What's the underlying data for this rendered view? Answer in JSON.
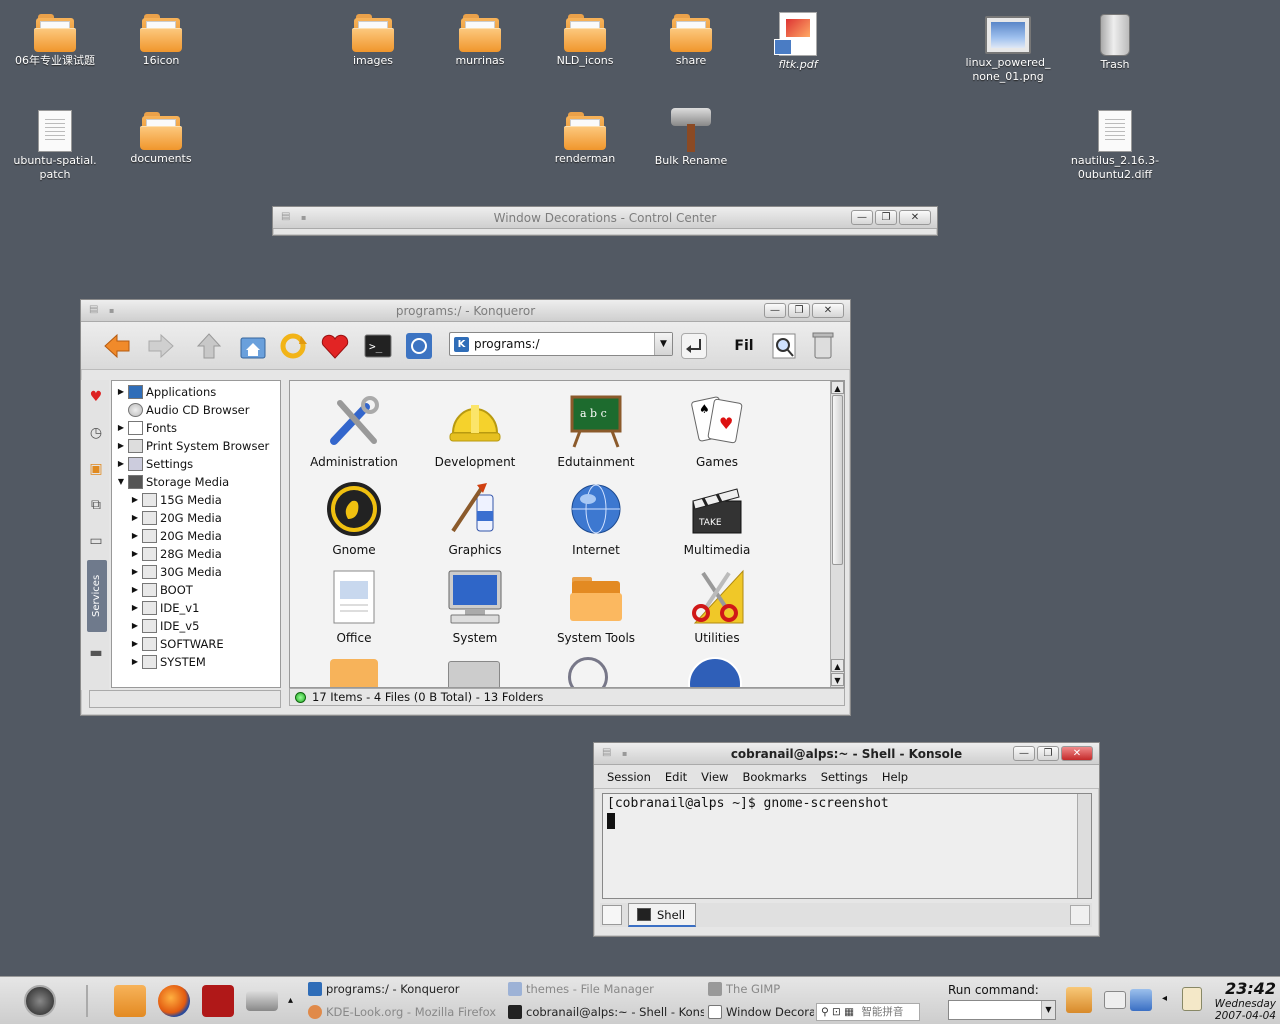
{
  "desktop": {
    "icons": [
      {
        "label": "06年专业课试题",
        "type": "folder"
      },
      {
        "label": "16icon",
        "type": "folder"
      },
      {
        "label": "images",
        "type": "folder"
      },
      {
        "label": "murrinas",
        "type": "folder"
      },
      {
        "label": "NLD_icons",
        "type": "folder"
      },
      {
        "label": "share",
        "type": "folder"
      },
      {
        "label": "fltk.pdf",
        "type": "pdf"
      },
      {
        "label": "linux_powered_\nnone_01.png",
        "type": "image"
      },
      {
        "label": "Trash",
        "type": "trash"
      },
      {
        "label": "ubuntu-spatial.\npatch",
        "type": "document"
      },
      {
        "label": "documents",
        "type": "folder"
      },
      {
        "label": "renderman",
        "type": "folder"
      },
      {
        "label": "Bulk Rename",
        "type": "app"
      },
      {
        "label": "nautilus_2.16.3-\n0ubuntu2.diff",
        "type": "document"
      }
    ]
  },
  "control_center": {
    "title": "Window Decorations - Control Center"
  },
  "konqueror": {
    "title": "programs:/ - Konqueror",
    "location": "programs:/",
    "toolbar": {
      "back": "back-arrow-icon",
      "forward": "forward-arrow-icon",
      "up": "up-arrow-icon",
      "home": "home-icon",
      "reload": "reload-icon",
      "bookmarks": "heart-icon",
      "terminal": "terminal-icon",
      "accessibility": "accessibility-icon",
      "go": "go-icon",
      "find": "Fil",
      "zoom": "zoom-icon",
      "trash": "trash-icon"
    },
    "tree": [
      {
        "label": "Applications",
        "level": 0,
        "expand": "collapsed",
        "icon": "kde-icon"
      },
      {
        "label": "Audio CD Browser",
        "level": 0,
        "expand": "none",
        "icon": "cd-icon"
      },
      {
        "label": "Fonts",
        "level": 0,
        "expand": "collapsed",
        "icon": "fonts-icon"
      },
      {
        "label": "Print System Browser",
        "level": 0,
        "expand": "collapsed",
        "icon": "printer-icon"
      },
      {
        "label": "Settings",
        "level": 0,
        "expand": "collapsed",
        "icon": "settings-icon"
      },
      {
        "label": "Storage Media",
        "level": 0,
        "expand": "expanded",
        "icon": "storage-icon"
      },
      {
        "label": "15G Media",
        "level": 1,
        "expand": "collapsed",
        "icon": "drive-icon"
      },
      {
        "label": "20G Media",
        "level": 1,
        "expand": "collapsed",
        "icon": "drive-icon"
      },
      {
        "label": "20G Media",
        "level": 1,
        "expand": "collapsed",
        "icon": "drive-icon"
      },
      {
        "label": "28G Media",
        "level": 1,
        "expand": "collapsed",
        "icon": "drive-icon"
      },
      {
        "label": "30G Media",
        "level": 1,
        "expand": "collapsed",
        "icon": "drive-icon"
      },
      {
        "label": "BOOT",
        "level": 1,
        "expand": "collapsed",
        "icon": "drive-icon"
      },
      {
        "label": "IDE_v1",
        "level": 1,
        "expand": "collapsed",
        "icon": "drive-icon"
      },
      {
        "label": "IDE_v5",
        "level": 1,
        "expand": "collapsed",
        "icon": "drive-icon"
      },
      {
        "label": "SOFTWARE",
        "level": 1,
        "expand": "collapsed",
        "icon": "drive-icon"
      },
      {
        "label": "SYSTEM",
        "level": 1,
        "expand": "collapsed",
        "icon": "drive-icon"
      }
    ],
    "sidebar_tab_label": "Services",
    "programs": [
      {
        "label": "Administration",
        "icon": "tools-icon"
      },
      {
        "label": "Development",
        "icon": "hardhat-icon"
      },
      {
        "label": "Edutainment",
        "icon": "blackboard-icon"
      },
      {
        "label": "Games",
        "icon": "cards-icon"
      },
      {
        "label": "Gnome",
        "icon": "gnome-foot-icon"
      },
      {
        "label": "Graphics",
        "icon": "paintbrush-icon"
      },
      {
        "label": "Internet",
        "icon": "globe-icon"
      },
      {
        "label": "Multimedia",
        "icon": "clapperboard-icon"
      },
      {
        "label": "Office",
        "icon": "document-icon"
      },
      {
        "label": "System",
        "icon": "monitor-icon"
      },
      {
        "label": "System Tools",
        "icon": "folder-icon"
      },
      {
        "label": "Utilities",
        "icon": "scissors-icon"
      }
    ],
    "status": "17 Items - 4 Files (0 B Total) - 13 Folders"
  },
  "konsole": {
    "title": "cobranail@alps:~ - Shell - Konsole",
    "menu": [
      "Session",
      "Edit",
      "View",
      "Bookmarks",
      "Settings",
      "Help"
    ],
    "prompt_line": "[cobranail@alps ~]$ gnome-screenshot",
    "tab_label": "Shell"
  },
  "taskbar": {
    "tasks": [
      {
        "label": "programs:/ - Konqueror",
        "state": "normal"
      },
      {
        "label": "themes - File Manager",
        "state": "dim"
      },
      {
        "label": "The GIMP",
        "state": "dim"
      },
      {
        "label": "KDE-Look.org - Mozilla Firefox",
        "state": "dim"
      },
      {
        "label": "cobranail@alps:~ - Shell - Konsole",
        "state": "normal"
      },
      {
        "label": "Window Decorations",
        "state": "normal"
      }
    ],
    "input_method": "智能拼音",
    "run_command_label": "Run command:",
    "clock_time": "23:42",
    "clock_day": "Wednesday",
    "clock_date": "2007-04-04"
  },
  "colors": {
    "desktop_bg": "#525963",
    "folder": "#f0962c",
    "close_button": "#c42a2a",
    "selection_accent": "#3a6fc4"
  }
}
